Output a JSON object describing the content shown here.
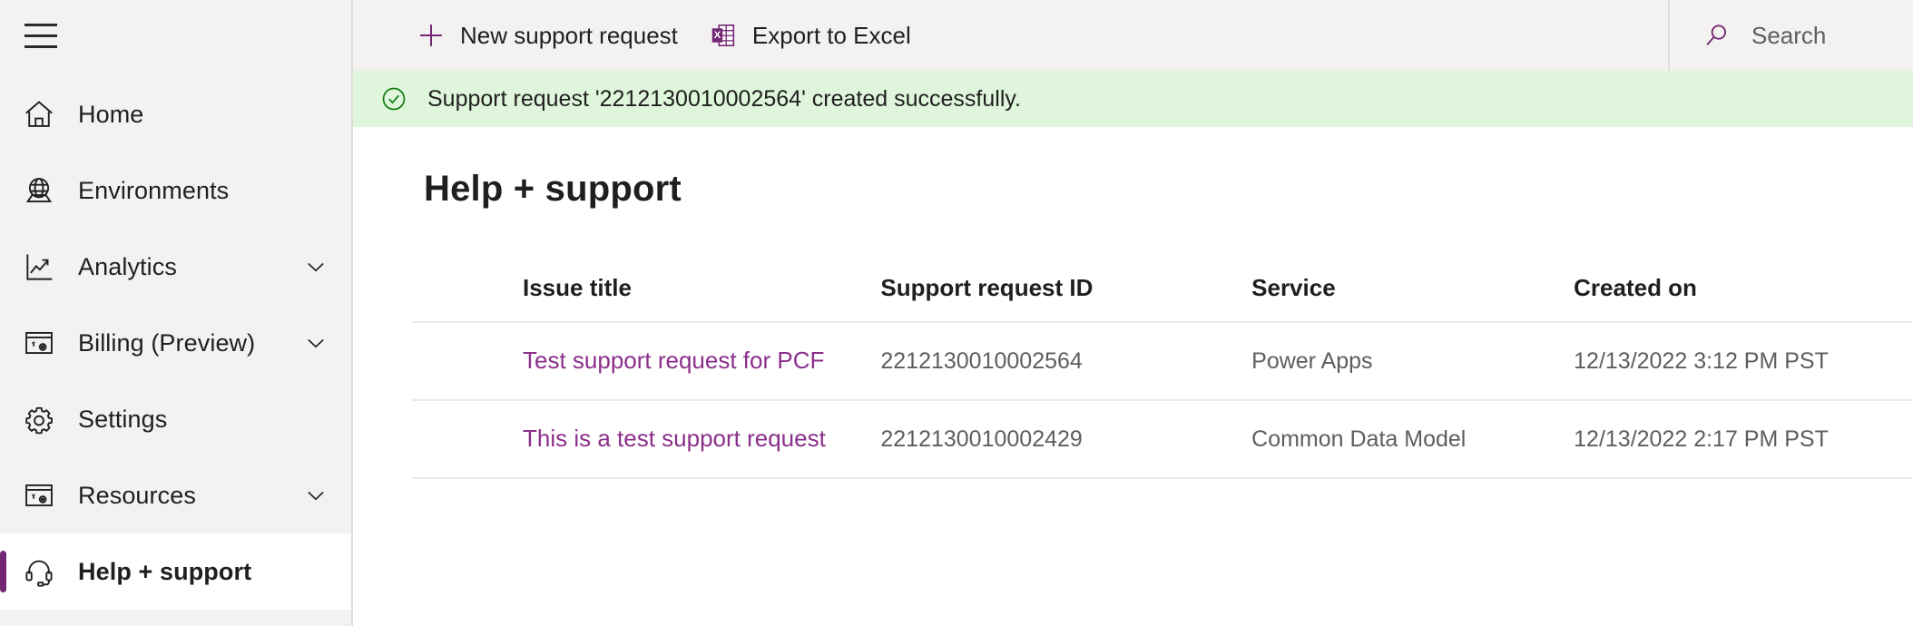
{
  "sidebar": {
    "menu_icon": "hamburger-icon",
    "items": [
      {
        "label": "Home",
        "icon": "home-icon",
        "expandable": false,
        "selected": false
      },
      {
        "label": "Environments",
        "icon": "globe-icon",
        "expandable": false,
        "selected": false
      },
      {
        "label": "Analytics",
        "icon": "analytics-icon",
        "expandable": true,
        "selected": false
      },
      {
        "label": "Billing (Preview)",
        "icon": "billing-icon",
        "expandable": true,
        "selected": false
      },
      {
        "label": "Settings",
        "icon": "gear-icon",
        "expandable": false,
        "selected": false
      },
      {
        "label": "Resources",
        "icon": "resources-icon",
        "expandable": true,
        "selected": false
      },
      {
        "label": "Help + support",
        "icon": "headset-icon",
        "expandable": false,
        "selected": true
      }
    ]
  },
  "command_bar": {
    "new_request_label": "New support request",
    "new_request_icon": "plus-icon",
    "export_label": "Export to Excel",
    "export_icon": "excel-icon",
    "search_placeholder": "Search",
    "search_icon": "search-icon"
  },
  "notification": {
    "icon": "check-circle-icon",
    "message": "Support request '2212130010002564' created successfully.",
    "background": "#dff6dd",
    "icon_color": "#107c10"
  },
  "page": {
    "title": "Help + support"
  },
  "table": {
    "columns": [
      "Issue title",
      "Support request ID",
      "Service",
      "Created on"
    ],
    "rows": [
      {
        "issue_title": "Test support request for PCF",
        "support_request_id": "2212130010002564",
        "service": "Power Apps",
        "created_on": "12/13/2022 3:12 PM PST"
      },
      {
        "issue_title": "This is a test support request",
        "support_request_id": "2212130010002429",
        "service": "Common Data Model",
        "created_on": "12/13/2022 2:17 PM PST"
      }
    ]
  },
  "colors": {
    "accent_purple": "#742774",
    "link_purple": "#8b2f8b",
    "sidebar_bg": "#f3f2f1",
    "success_green": "#dff6dd",
    "border": "#edebe9"
  }
}
